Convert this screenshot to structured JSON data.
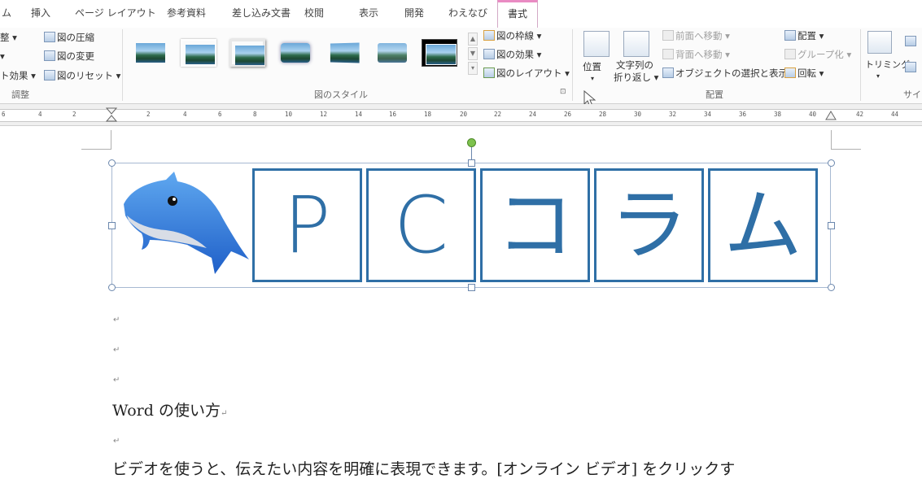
{
  "tabs": [
    "ム",
    "挿入",
    "ページ レイアウト",
    "参考資料",
    "差し込み文書",
    "校閲",
    "表示",
    "開発",
    "わえなび",
    "書式"
  ],
  "ribbon": {
    "adjust": {
      "items": [
        "整 ▾",
        "▾",
        "ト効果 ▾"
      ],
      "compress": "図の圧縮",
      "change": "図の変更",
      "reset": "図のリセット ▾",
      "label": "調整"
    },
    "styles": {
      "border": "図の枠線 ▾",
      "effects": "図の効果 ▾",
      "layout": "図のレイアウト ▾",
      "label": "図のスタイル",
      "launcher": "⊡"
    },
    "arrange": {
      "position": "位置",
      "position_arrow": "▾",
      "wrap_line1": "文字列の",
      "wrap_line2": "折り返し ▾",
      "bring_forward": "前面へ移動 ▾",
      "send_backward": "背面へ移動 ▾",
      "selection_pane": "オブジェクトの選択と表示",
      "align": "配置 ▾",
      "group": "グループ化 ▾",
      "rotate": "回転 ▾",
      "label": "配置"
    },
    "size": {
      "crop": "トリミング",
      "crop_arrow": "▾",
      "label": "サイ"
    }
  },
  "ruler": {
    "ticks": [
      "6",
      "4",
      "2",
      "2",
      "4",
      "6",
      "8",
      "10",
      "12",
      "14",
      "16",
      "18",
      "20",
      "22",
      "24",
      "26",
      "28",
      "30",
      "32",
      "34",
      "36",
      "38",
      "40",
      "42",
      "44"
    ]
  },
  "document": {
    "banner_letters": [
      "P",
      "C",
      "コ",
      "ラ",
      "ム"
    ],
    "heading": "Word の使い方",
    "body_line": "ビデオを使うと、伝えたい内容を明確に表現できます。[オンライン ビデオ] をクリックす",
    "para_mark": "↵"
  },
  "colors": {
    "accent_tab": "#e98bc3",
    "banner_blue": "#2f6fa6"
  }
}
